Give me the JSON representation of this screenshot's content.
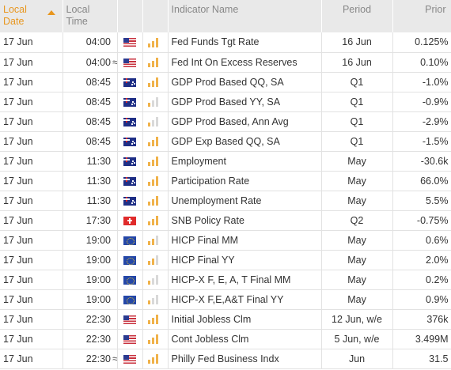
{
  "header": {
    "date_line1": "Local",
    "date_line2": "Date",
    "time_line1": "Local",
    "time_line2": "Time",
    "indicator": "Indicator Name",
    "period": "Period",
    "prior": "Prior"
  },
  "rows": [
    {
      "date": "17 Jun",
      "time": "04:00",
      "approx": "",
      "flag": "us-flag-icon",
      "importance": 3,
      "name": "Fed Funds Tgt Rate",
      "period": "16 Jun",
      "prior": "0.125%"
    },
    {
      "date": "17 Jun",
      "time": "04:00",
      "approx": "≈",
      "flag": "us-flag-icon",
      "importance": 3,
      "name": "Fed Int On Excess Reserves",
      "period": "16 Jun",
      "prior": "0.10%"
    },
    {
      "date": "17 Jun",
      "time": "08:45",
      "approx": "",
      "flag": "au-flag-icon",
      "importance": 3,
      "name": "GDP Prod Based QQ, SA",
      "period": "Q1",
      "prior": "-1.0%"
    },
    {
      "date": "17 Jun",
      "time": "08:45",
      "approx": "",
      "flag": "au-flag-icon",
      "importance": 1,
      "name": "GDP Prod Based YY, SA",
      "period": "Q1",
      "prior": "-0.9%"
    },
    {
      "date": "17 Jun",
      "time": "08:45",
      "approx": "",
      "flag": "au-flag-icon",
      "importance": 1,
      "name": "GDP Prod Based, Ann Avg",
      "period": "Q1",
      "prior": "-2.9%"
    },
    {
      "date": "17 Jun",
      "time": "08:45",
      "approx": "",
      "flag": "au-flag-icon",
      "importance": 3,
      "name": "GDP Exp Based QQ, SA",
      "period": "Q1",
      "prior": "-1.5%"
    },
    {
      "date": "17 Jun",
      "time": "11:30",
      "approx": "",
      "flag": "au-flag-icon",
      "importance": 3,
      "name": "Employment",
      "period": "May",
      "prior": "-30.6k"
    },
    {
      "date": "17 Jun",
      "time": "11:30",
      "approx": "",
      "flag": "au-flag-icon",
      "importance": 3,
      "name": "Participation Rate",
      "period": "May",
      "prior": "66.0%"
    },
    {
      "date": "17 Jun",
      "time": "11:30",
      "approx": "",
      "flag": "au-flag-icon",
      "importance": 3,
      "name": "Unemployment Rate",
      "period": "May",
      "prior": "5.5%"
    },
    {
      "date": "17 Jun",
      "time": "17:30",
      "approx": "",
      "flag": "ch-flag-icon",
      "importance": 3,
      "name": "SNB Policy Rate",
      "period": "Q2",
      "prior": "-0.75%"
    },
    {
      "date": "17 Jun",
      "time": "19:00",
      "approx": "",
      "flag": "eu-flag-icon",
      "importance": 2,
      "name": "HICP Final MM",
      "period": "May",
      "prior": "0.6%"
    },
    {
      "date": "17 Jun",
      "time": "19:00",
      "approx": "",
      "flag": "eu-flag-icon",
      "importance": 2,
      "name": "HICP Final YY",
      "period": "May",
      "prior": "2.0%"
    },
    {
      "date": "17 Jun",
      "time": "19:00",
      "approx": "",
      "flag": "eu-flag-icon",
      "importance": 1,
      "name": "HICP-X F, E, A, T Final MM",
      "period": "May",
      "prior": "0.2%"
    },
    {
      "date": "17 Jun",
      "time": "19:00",
      "approx": "",
      "flag": "eu-flag-icon",
      "importance": 1,
      "name": "HICP-X F,E,A&T Final YY",
      "period": "May",
      "prior": "0.9%"
    },
    {
      "date": "17 Jun",
      "time": "22:30",
      "approx": "",
      "flag": "us-flag-icon",
      "importance": 3,
      "name": "Initial Jobless Clm",
      "period": "12 Jun, w/e",
      "prior": "376k"
    },
    {
      "date": "17 Jun",
      "time": "22:30",
      "approx": "",
      "flag": "us-flag-icon",
      "importance": 3,
      "name": "Cont Jobless Clm",
      "period": "5 Jun, w/e",
      "prior": "3.499M"
    },
    {
      "date": "17 Jun",
      "time": "22:30",
      "approx": "≈",
      "flag": "us-flag-icon",
      "importance": 3,
      "name": "Philly Fed Business Indx",
      "period": "Jun",
      "prior": "31.5"
    }
  ]
}
